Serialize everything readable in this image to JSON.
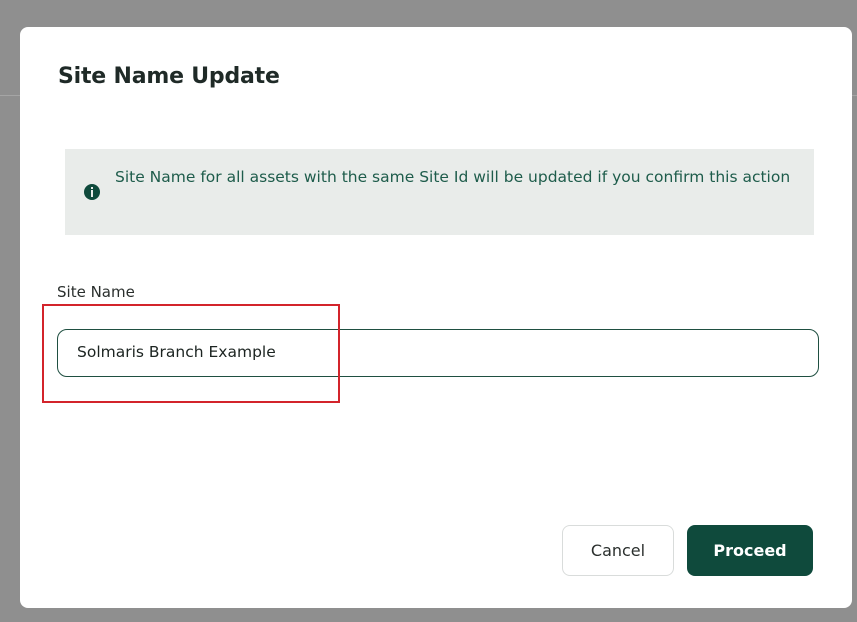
{
  "dialog": {
    "title": "Site Name Update",
    "info_message": "Site Name for all assets with the same Site Id will be updated if you confirm this action",
    "site_name": {
      "label": "Site Name",
      "value": "Solmaris Branch Example"
    },
    "buttons": {
      "cancel_label": "Cancel",
      "proceed_label": "Proceed"
    }
  },
  "colors": {
    "primary": "#0f4a3c",
    "alert_background": "#e9ecea",
    "alert_text": "#1e5c4b",
    "highlight_annotation": "#d3242b",
    "overlay": "#8f8f8f"
  },
  "icons": {
    "alert": "info-icon"
  }
}
